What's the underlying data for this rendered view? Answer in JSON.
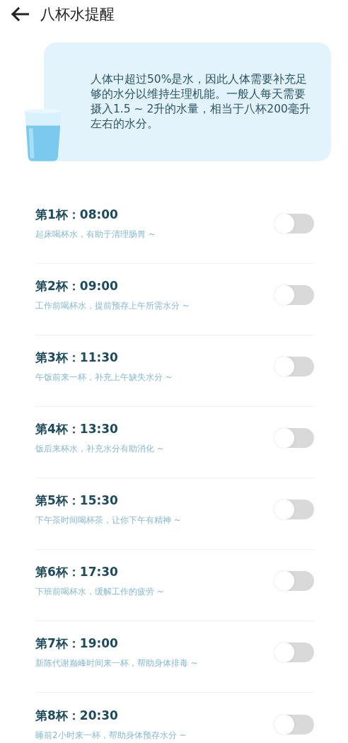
{
  "header": {
    "title": "八杯水提醒"
  },
  "intro": {
    "text": "人体中超过50%是水，因此人体需要补充足够的水分以维持生理机能。一般人每天需要摄入1.5 ~ 2升的水量，相当于八杯200毫升左右的水分。"
  },
  "reminders": [
    {
      "title": "第1杯：08:00",
      "note": "起床喝杯水，有助于清理肠胃 ~",
      "on": false
    },
    {
      "title": "第2杯：09:00",
      "note": "工作前喝杯水，提前预存上午所需水分 ~",
      "on": false
    },
    {
      "title": "第3杯：11:30",
      "note": "午饭前来一杯，补充上午缺失水分 ~",
      "on": false
    },
    {
      "title": "第4杯：13:30",
      "note": "饭后来杯水，补充水分有助消化 ~",
      "on": false
    },
    {
      "title": "第5杯：15:30",
      "note": "下午茶时间喝杯茶，让你下午有精神 ~",
      "on": false
    },
    {
      "title": "第6杯：17:30",
      "note": "下班前喝杯水，缓解工作的疲劳 ~",
      "on": false
    },
    {
      "title": "第7杯：19:00",
      "note": "新陈代谢巅峰时间来一杯，帮助身体排毒 ~",
      "on": false
    },
    {
      "title": "第8杯：20:30",
      "note": "睡前2小时来一杯，帮助身体预存水分 ~",
      "on": false
    }
  ]
}
